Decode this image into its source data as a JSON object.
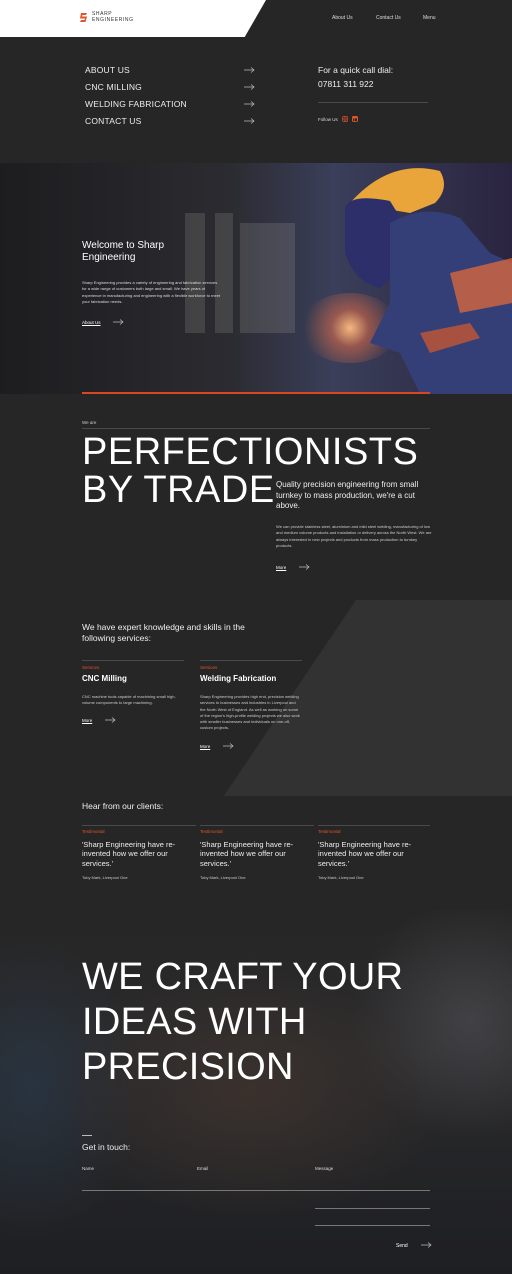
{
  "header": {
    "logo_top": "Sharp",
    "logo_bottom": "Engineering",
    "nav": [
      "About Us",
      "Contact Us",
      "Menu"
    ]
  },
  "menu": {
    "items": [
      "ABOUT US",
      "CNC MILLING",
      "WELDING FABRICATION",
      "CONTACT US"
    ],
    "call_label": "For a quick call dial:",
    "phone": "07811 311 922",
    "follow_label": "Follow Us",
    "social_icons": [
      "instagram-icon",
      "linkedin-icon"
    ]
  },
  "hero": {
    "title": "Welcome to Sharp Engineering",
    "text": "Sharp Engineering provides a variety of engineering and fabrication services for a wide range of customers both large and small. We have years of experience in manufacturing and engineering with a flexible workforce to meet your fabrication needs.",
    "link": "About Us"
  },
  "intro": {
    "eyebrow": "We are",
    "headline_1": "PERFECTIONISTS",
    "headline_2": "BY TRADE",
    "lead": "Quality precision engineering from small turnkey to mass production, we're a cut above.",
    "body": "We can provide stainless steel, aluminium and mild steel welding, manufacturing of low and medium volume products and installation or delivery across the North West. We are always interested in new projects and products from mass production to turnkey products.",
    "more": "More"
  },
  "services": {
    "title": "We have expert knowledge and skills in the following services:",
    "cards": [
      {
        "caption": "Services",
        "heading": "CNC Milling",
        "text": "CNC machine tools capable of machining small high-volume components to large machining.",
        "more": "More"
      },
      {
        "caption": "Services",
        "heading": "Welding Fabrication",
        "text": "Sharp Engineering provides high end, precision welding services to businesses and industries in Liverpool and the North West of England. As well as working on some of the region's high-profile welding projects we also work with smaller businesses and individuals on one-off, custom projects.",
        "more": "More"
      }
    ]
  },
  "clients": {
    "title": "Hear from our clients:",
    "testimonials": [
      {
        "caption": "Testimonial",
        "quote": "'Sharp Engineering have re-invented how we offer our services.'",
        "author": "Toby Mark, Liverpool One"
      },
      {
        "caption": "Testimonial",
        "quote": "'Sharp Engineering have re-invented how we offer our services.'",
        "author": "Toby Mark, Liverpool One"
      },
      {
        "caption": "Testimonial",
        "quote": "'Sharp Engineering have re-invented how we offer our services.'",
        "author": "Toby Mark, Liverpool One"
      }
    ]
  },
  "craft": {
    "line_1": "WE CRAFT YOUR",
    "line_2": "IDEAS WITH",
    "line_3": "PRECISION"
  },
  "contact": {
    "title": "Get in touch:",
    "name_label": "Name",
    "email_label": "Email",
    "message_label": "Message",
    "send": "Send"
  },
  "colors": {
    "background": "#262626",
    "accent": "#e0562a"
  }
}
